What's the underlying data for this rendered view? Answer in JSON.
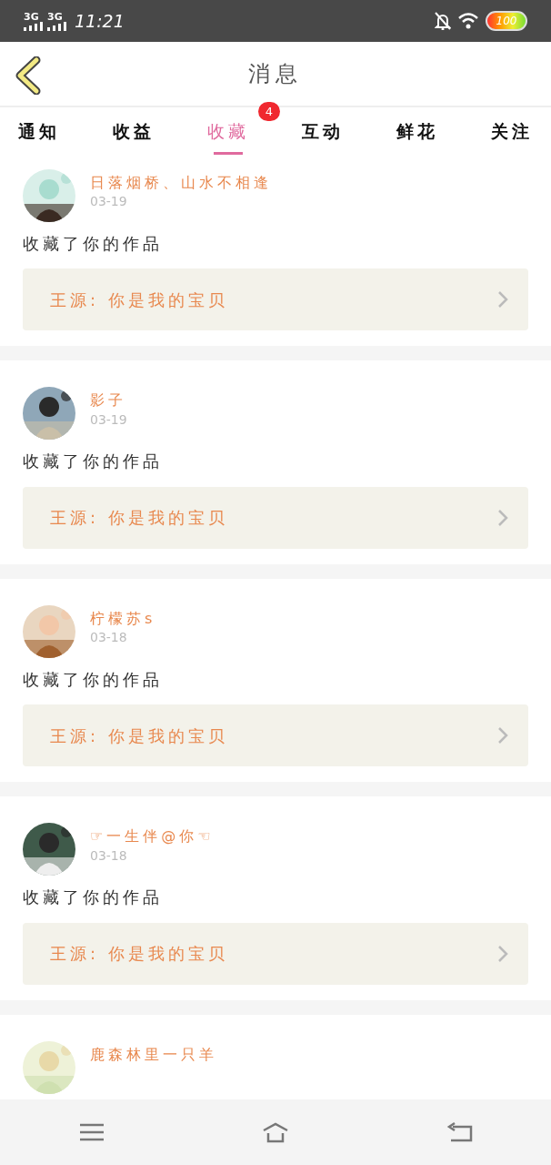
{
  "status_bar": {
    "signals": [
      {
        "label": "3G"
      },
      {
        "label": "3G"
      }
    ],
    "time": "11:21",
    "battery": "100"
  },
  "header": {
    "title": "消息"
  },
  "tabs": [
    {
      "label": "通知",
      "selected": false
    },
    {
      "label": "收益",
      "selected": false
    },
    {
      "label": "收藏",
      "selected": true,
      "badge": "4"
    },
    {
      "label": "互动",
      "selected": false
    },
    {
      "label": "鲜花",
      "selected": false
    },
    {
      "label": "关注",
      "selected": false
    }
  ],
  "messages": [
    {
      "name": "日落烟桥、山水不相逢",
      "date": "03-19",
      "action": "收藏了你的作品",
      "source": "王源: 你是我的宝贝"
    },
    {
      "name": "影子",
      "date": "03-19",
      "action": "收藏了你的作品",
      "source": "王源: 你是我的宝贝"
    },
    {
      "name": "柠檬苏s",
      "date": "03-18",
      "action": "收藏了你的作品",
      "source": "王源: 你是我的宝贝"
    },
    {
      "name": "☞一生伴@你☜",
      "date": "03-18",
      "action": "收藏了你的作品",
      "source": "王源: 你是我的宝贝"
    },
    {
      "name": "鹿森林里一只羊"
    }
  ]
}
